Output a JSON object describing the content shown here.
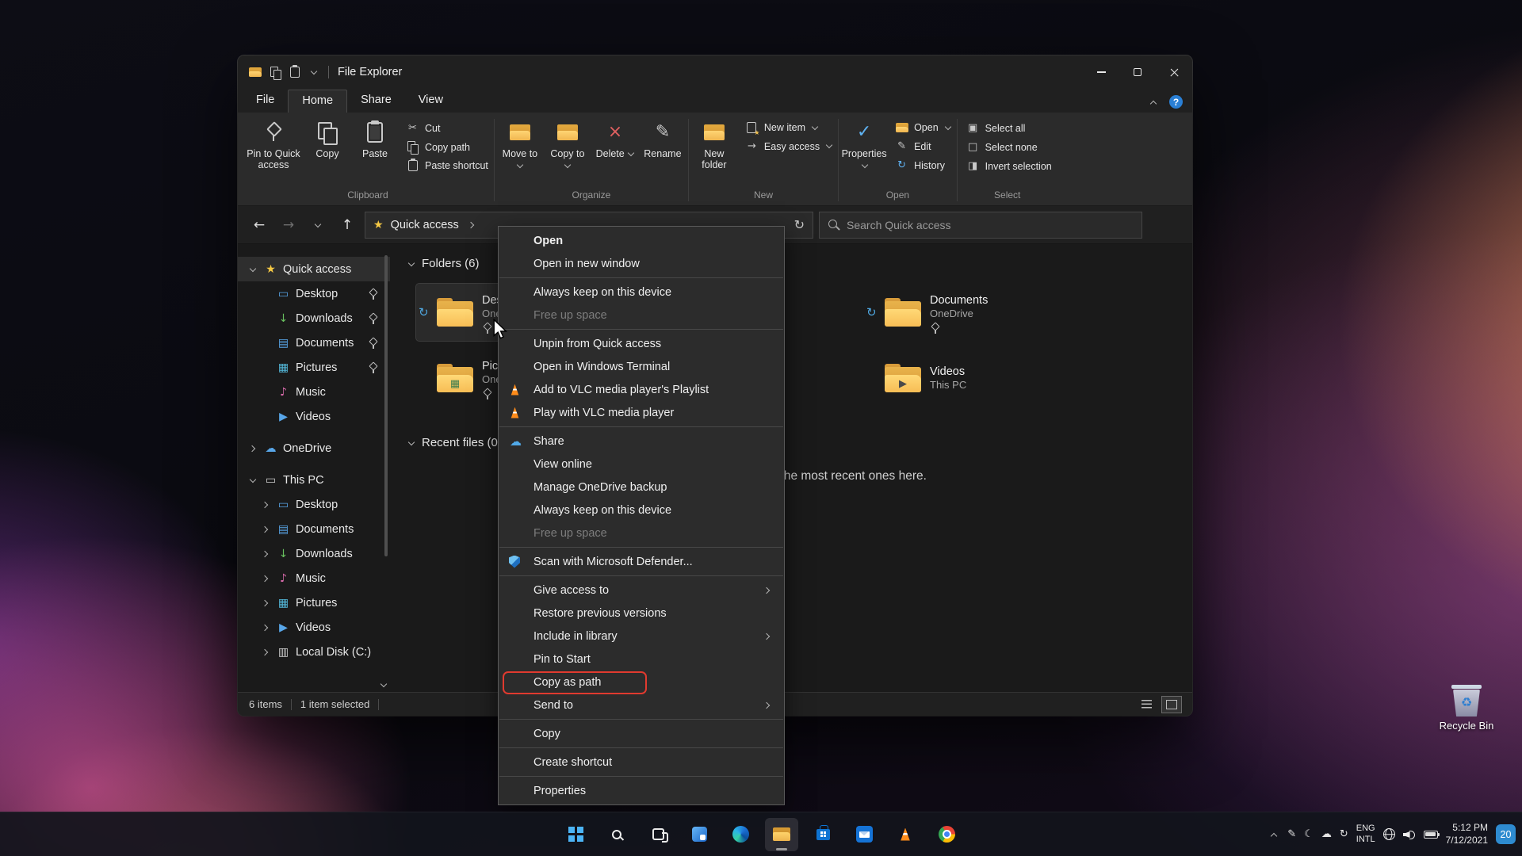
{
  "desktop": {
    "recycle_bin_label": "Recycle Bin"
  },
  "window": {
    "title": "File Explorer"
  },
  "icons": {
    "cut": "✂",
    "delete": "×",
    "rename": "✎",
    "check": "✓",
    "history": "↻",
    "refresh": "↻",
    "back": "←",
    "forward": "→",
    "up": "↑",
    "star": "★",
    "arrow_right": "→",
    "edit": "✎",
    "select_all": "▣",
    "select_none": "□",
    "invert": "◨",
    "cloud": "☁",
    "sync": "↻",
    "pen": "✎",
    "moon": "☾",
    "help": "?",
    "recycle": "♻"
  },
  "tabs": [
    {
      "label": "File",
      "cls": "tab-file"
    },
    {
      "label": "Home",
      "cls": "tab-active"
    },
    {
      "label": "Share",
      "cls": ""
    },
    {
      "label": "View",
      "cls": ""
    }
  ],
  "ribbon": {
    "clipboard": {
      "label": "Clipboard",
      "pin": "Pin to Quick access",
      "copy": "Copy",
      "paste": "Paste",
      "cut": "Cut",
      "copy_path": "Copy path",
      "paste_shortcut": "Paste shortcut"
    },
    "organize": {
      "label": "Organize",
      "move_to": "Move to",
      "copy_to": "Copy to",
      "delete": "Delete",
      "rename": "Rename"
    },
    "new": {
      "label": "New",
      "new_folder": "New folder",
      "new_item": "New item",
      "easy_access": "Easy access"
    },
    "open": {
      "label": "Open",
      "properties": "Properties",
      "open": "Open",
      "edit": "Edit",
      "history": "History"
    },
    "select": {
      "label": "Select",
      "select_all": "Select all",
      "select_none": "Select none",
      "invert": "Invert selection"
    }
  },
  "navbar": {
    "breadcrumb_root": "Quick access",
    "search_placeholder": "Search Quick access"
  },
  "sidebar": {
    "items": [
      {
        "name": "sidebar-item-quick-access",
        "label": "Quick access",
        "glyph": "★",
        "iconcls": "ic-gold",
        "icon": "quick-access-star-icon",
        "chevron": "cv-d",
        "cls": "lvl0 sel-row"
      },
      {
        "name": "sidebar-item-desktop",
        "label": "Desktop",
        "glyph": "▭",
        "iconcls": "ic-blue",
        "icon": "desktop-icon",
        "cls": "lvl1",
        "pinned": true
      },
      {
        "name": "sidebar-item-downloads",
        "label": "Downloads",
        "glyph": "↓",
        "iconcls": "ic-green",
        "icon": "downloads-icon",
        "cls": "lvl1",
        "pinned": true
      },
      {
        "name": "sidebar-item-documents",
        "label": "Documents",
        "glyph": "▤",
        "iconcls": "ic-blue",
        "icon": "documents-icon",
        "cls": "lvl1",
        "pinned": true
      },
      {
        "name": "sidebar-item-pictures",
        "label": "Pictures",
        "glyph": "▦",
        "iconcls": "ic-teal",
        "icon": "pictures-icon",
        "cls": "lvl1",
        "pinned": true
      },
      {
        "name": "sidebar-item-music",
        "label": "Music",
        "glyph": "♪",
        "iconcls": "ic-pink",
        "icon": "music-icon",
        "cls": "lvl1"
      },
      {
        "name": "sidebar-item-videos",
        "label": "Videos",
        "glyph": "▶",
        "iconcls": "ic-blue",
        "icon": "videos-icon",
        "cls": "lvl1"
      },
      {
        "name": "sidebar-item-onedrive",
        "label": "OneDrive",
        "glyph": "☁",
        "iconcls": "ic-blue",
        "icon": "onedrive-icon",
        "chevron": "cv-r",
        "cls": "lvl0 gap"
      },
      {
        "name": "sidebar-item-this-pc",
        "label": "This PC",
        "glyph": "▭",
        "iconcls": "ic-light",
        "icon": "this-pc-icon",
        "chevron": "cv-d",
        "cls": "lvl0 gap"
      },
      {
        "name": "sidebar-item-pc-desktop",
        "label": "Desktop",
        "glyph": "▭",
        "iconcls": "ic-blue",
        "icon": "desktop-icon",
        "chevron": "cv-r",
        "cls": "lvl1"
      },
      {
        "name": "sidebar-item-pc-documents",
        "label": "Documents",
        "glyph": "▤",
        "iconcls": "ic-blue",
        "icon": "documents-icon",
        "chevron": "cv-r",
        "cls": "lvl1"
      },
      {
        "name": "sidebar-item-pc-downloads",
        "label": "Downloads",
        "glyph": "↓",
        "iconcls": "ic-green",
        "icon": "downloads-icon",
        "chevron": "cv-r",
        "cls": "lvl1"
      },
      {
        "name": "sidebar-item-pc-music",
        "label": "Music",
        "glyph": "♪",
        "iconcls": "ic-pink",
        "icon": "music-icon",
        "chevron": "cv-r",
        "cls": "lvl1"
      },
      {
        "name": "sidebar-item-pc-pictures",
        "label": "Pictures",
        "glyph": "▦",
        "iconcls": "ic-teal",
        "icon": "pictures-icon",
        "chevron": "cv-r",
        "cls": "lvl1"
      },
      {
        "name": "sidebar-item-pc-videos",
        "label": "Videos",
        "glyph": "▶",
        "iconcls": "ic-blue",
        "icon": "videos-icon",
        "chevron": "cv-r",
        "cls": "lvl1"
      },
      {
        "name": "sidebar-item-local-disk-c",
        "label": "Local Disk (C:)",
        "glyph": "▥",
        "iconcls": "ic-light",
        "icon": "local-disk-icon",
        "chevron": "cv-r",
        "cls": "lvl1"
      }
    ]
  },
  "content": {
    "folders_header": "Folders (6)",
    "recent_header": "Recent files (0)",
    "recent_empty": "After you've opened some files, we'll show the most recent ones here.",
    "tiles": [
      {
        "name": "Desktop",
        "location": "OneDrive",
        "cls": "sel",
        "status": "sync",
        "statusglyph": "↻",
        "statuscls": "st-sync",
        "statusicon": "onedrive-sync-icon",
        "pinned": true
      },
      {
        "name": "Pictures",
        "location": "OneDrive",
        "pinned": true,
        "badge": "▦",
        "badgecls": "bg-pic"
      },
      {
        "name": "Documents",
        "location": "OneDrive",
        "status": "sync",
        "statusglyph": "↻",
        "statuscls": "st-sync",
        "statusicon": "onedrive-sync-icon",
        "pinned": true
      },
      {
        "name": "Videos",
        "location": "This PC",
        "badge": "▶",
        "badgecls": "bg-play"
      }
    ]
  },
  "statusbar": {
    "items": "6 items",
    "selected": "1 item selected"
  },
  "context_menu": {
    "items": [
      {
        "label": "Open",
        "cls": "bold"
      },
      {
        "label": "Open in new window"
      },
      {
        "sep": true
      },
      {
        "label": "Always keep on this device"
      },
      {
        "label": "Free up space",
        "cls": "disabled"
      },
      {
        "sep": true
      },
      {
        "label": "Unpin from Quick access"
      },
      {
        "label": "Open in Windows Terminal"
      },
      {
        "label": "Add to VLC media player's Playlist",
        "icon": "vlc-cone-icon",
        "iconcls": "mi-vlc"
      },
      {
        "label": "Play with VLC media player",
        "icon": "vlc-cone-icon",
        "iconcls": "mi-vlc"
      },
      {
        "sep": true
      },
      {
        "label": "Share",
        "icon": "onedrive-cloud-icon",
        "iconcls": "mi-cloud",
        "glyph": "☁"
      },
      {
        "label": "View online"
      },
      {
        "label": "Manage OneDrive backup"
      },
      {
        "label": "Always keep on this device"
      },
      {
        "label": "Free up space",
        "cls": "disabled"
      },
      {
        "sep": true
      },
      {
        "label": "Scan with Microsoft Defender...",
        "icon": "defender-shield-icon",
        "iconcls": "mi-shield"
      },
      {
        "sep": true
      },
      {
        "label": "Give access to",
        "submenu": true
      },
      {
        "label": "Restore previous versions"
      },
      {
        "label": "Include in library",
        "submenu": true
      },
      {
        "label": "Pin to Start"
      },
      {
        "label": "Copy as path",
        "cls": "ann-red"
      },
      {
        "label": "Send to",
        "submenu": true
      },
      {
        "sep": true
      },
      {
        "label": "Copy"
      },
      {
        "sep": true
      },
      {
        "label": "Create shortcut"
      },
      {
        "sep": true
      },
      {
        "label": "Properties"
      }
    ]
  },
  "taskbar": {
    "icons": [
      {
        "name": "start-button",
        "cls": "tb-start"
      },
      {
        "name": "search-button",
        "cls": "tb-search"
      },
      {
        "name": "task-view-button",
        "cls": "tb-taskview"
      },
      {
        "name": "widgets-button",
        "cls": "tb-widgets"
      },
      {
        "name": "edge-browser-icon",
        "cls": "tb-edge"
      },
      {
        "name": "file-explorer-icon",
        "cls": "tb-explorer active",
        "active": true
      },
      {
        "name": "microsoft-store-icon",
        "cls": "tb-store"
      },
      {
        "name": "mail-icon",
        "cls": "tb-mail"
      },
      {
        "name": "vlc-player-icon",
        "cls": "tb-vlc"
      },
      {
        "name": "chrome-browser-icon",
        "cls": "tb-chrome"
      }
    ],
    "tray": {
      "lang1": "ENG",
      "lang2": "INTL",
      "time": "5:12 PM",
      "date": "7/12/2021",
      "badge": "20"
    }
  }
}
